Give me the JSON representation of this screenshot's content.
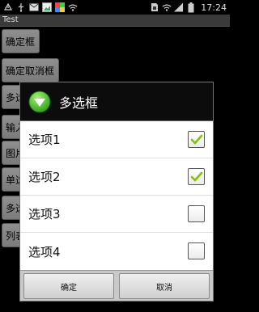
{
  "status_bar": {
    "time": "17:24",
    "icons": [
      "notification-icon",
      "usb-icon",
      "message-icon",
      "image-icon",
      "app-icon",
      "wifi-icon",
      "sim-icon",
      "signal-icon",
      "battery-icon"
    ]
  },
  "app": {
    "title": "Test"
  },
  "background_buttons": [
    "确定框",
    "确定取消框",
    "多选框",
    "输入框",
    "图片框",
    "单选框",
    "多选框",
    "列表框"
  ],
  "dialog": {
    "title": "多选框",
    "items": [
      {
        "label": "选项1",
        "checked": true
      },
      {
        "label": "选项2",
        "checked": true
      },
      {
        "label": "选项3",
        "checked": false
      },
      {
        "label": "选项4",
        "checked": false
      }
    ],
    "ok_label": "确定",
    "cancel_label": "取消"
  },
  "colors": {
    "check_green": "#7ec400",
    "icon_green": "#3fbf1f"
  }
}
